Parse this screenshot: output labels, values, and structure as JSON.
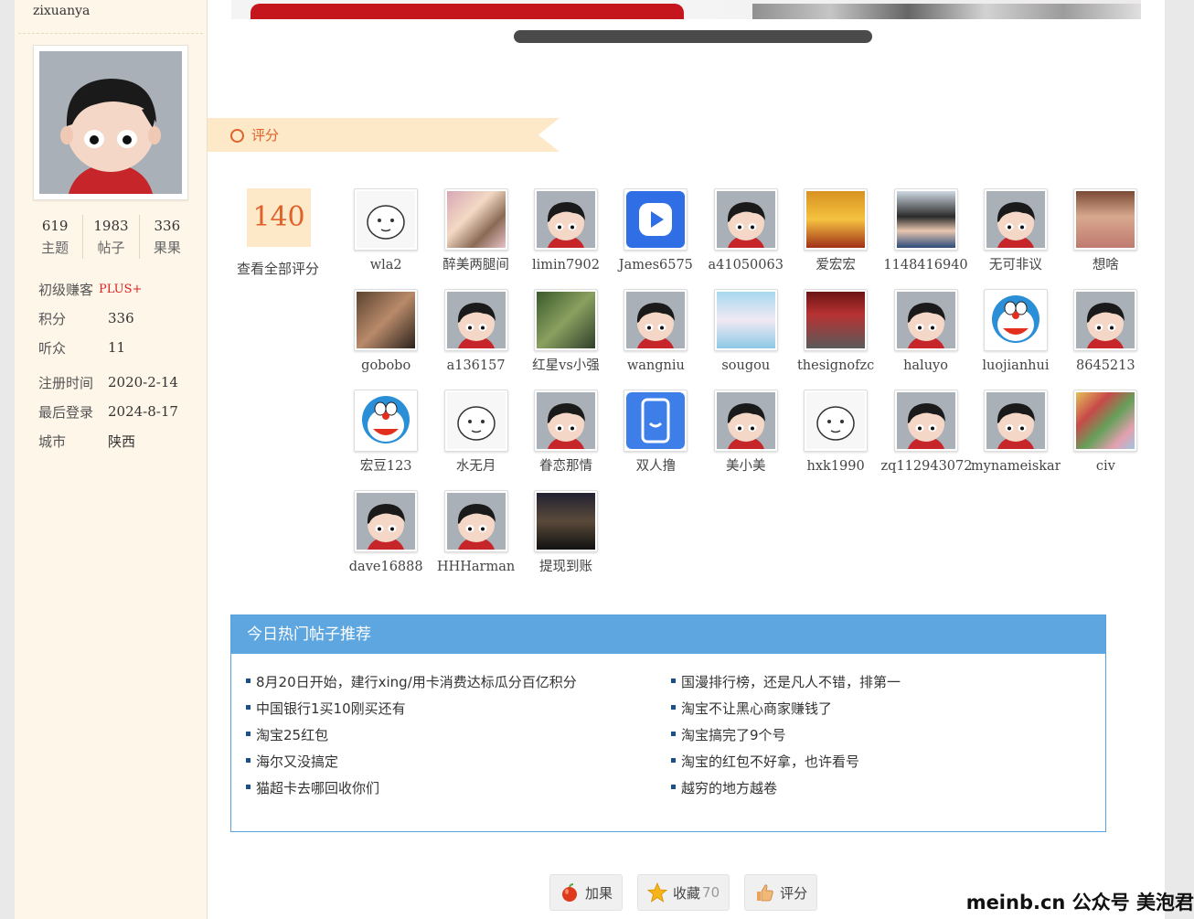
{
  "profile": {
    "username": "zixuanya",
    "stats": [
      {
        "num": "619",
        "label": "主题"
      },
      {
        "num": "1983",
        "label": "帖子"
      },
      {
        "num": "336",
        "label": "果果"
      }
    ],
    "level": "初级赚客",
    "level_badge": "PLUS+",
    "info": [
      {
        "k": "积分",
        "v": "336"
      },
      {
        "k": "听众",
        "v": "11"
      }
    ],
    "info2": [
      {
        "k": "注册时间",
        "v": "2020-2-14"
      },
      {
        "k": "最后登录",
        "v": "2024-8-17"
      },
      {
        "k": "城市",
        "v": "陕西"
      }
    ]
  },
  "rating": {
    "tab_title": "评分",
    "score": "140",
    "view_all": "查看全部评分",
    "raters": [
      {
        "name": "wla2",
        "avatar": "cat"
      },
      {
        "name": "醉美两腿间",
        "avatar": "photo-pink"
      },
      {
        "name": "limin7902",
        "avatar": "default"
      },
      {
        "name": "James6575",
        "avatar": "blue-app"
      },
      {
        "name": "a41050063",
        "avatar": "default"
      },
      {
        "name": "爱宏宏",
        "avatar": "game"
      },
      {
        "name": "1148416940",
        "avatar": "anime"
      },
      {
        "name": "无可非议",
        "avatar": "default"
      },
      {
        "name": "想啥",
        "avatar": "girl"
      },
      {
        "name": "gobobo",
        "avatar": "man"
      },
      {
        "name": "a136157",
        "avatar": "default"
      },
      {
        "name": "红星vs小强",
        "avatar": "bike"
      },
      {
        "name": "wangniu",
        "avatar": "default"
      },
      {
        "name": "sougou",
        "avatar": "bride"
      },
      {
        "name": "thesignofzc",
        "avatar": "forest"
      },
      {
        "name": "haluyo",
        "avatar": "default"
      },
      {
        "name": "luojianhui",
        "avatar": "dora"
      },
      {
        "name": "8645213",
        "avatar": "default"
      },
      {
        "name": "宏豆123",
        "avatar": "dora"
      },
      {
        "name": "水无月",
        "avatar": "rabbit"
      },
      {
        "name": "眷恋那情",
        "avatar": "default"
      },
      {
        "name": "双人撸",
        "avatar": "blue-phone"
      },
      {
        "name": "美小美",
        "avatar": "default"
      },
      {
        "name": "hxk1990",
        "avatar": "glasses"
      },
      {
        "name": "zq112943072",
        "avatar": "default"
      },
      {
        "name": "mynameiskar",
        "avatar": "default"
      },
      {
        "name": "civ",
        "avatar": "collage"
      },
      {
        "name": "dave16888",
        "avatar": "default"
      },
      {
        "name": "HHHarman",
        "avatar": "default"
      },
      {
        "name": "提现到账",
        "avatar": "dark"
      }
    ]
  },
  "hot": {
    "title": "今日热门帖子推荐",
    "left": [
      "8月20日开始，建行xing/用卡消费达标瓜分百亿积分",
      "中国银行1买10刚买还有",
      "淘宝25红包",
      "海尔又没搞定",
      "猫超卡去哪回收你们"
    ],
    "right": [
      "国漫排行榜，还是凡人不错，排第一",
      "淘宝不让黑心商家赚钱了",
      "淘宝搞完了9个号",
      "淘宝的红包不好拿，也许看号",
      "越穷的地方越卷"
    ]
  },
  "actions": {
    "add_fruit": "加果",
    "favorite": "收藏",
    "favorite_count": "70",
    "rate": "评分"
  },
  "watermark": "meinb.cn 公众号 美泡君"
}
